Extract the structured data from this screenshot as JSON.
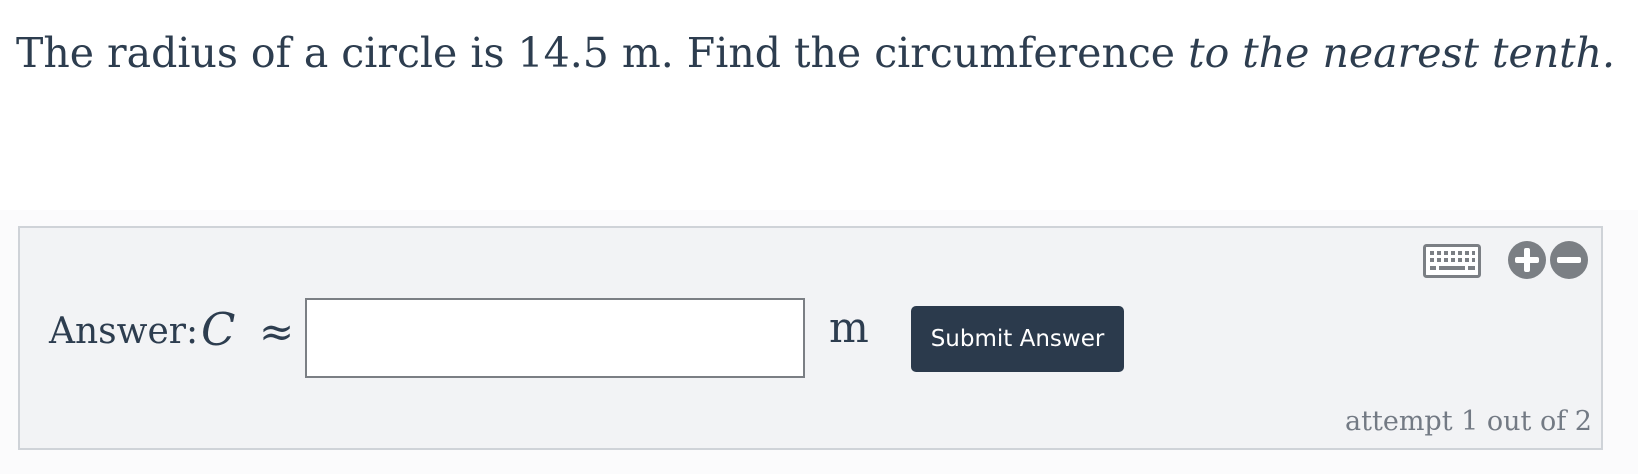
{
  "question": {
    "text_main": "The radius of a circle is 14.5 m. Find the circumference ",
    "text_instruction": "to the nearest tenth."
  },
  "answer": {
    "label": "Answer:",
    "variable": "C",
    "relation": "≈",
    "input_value": "",
    "input_placeholder": "",
    "unit": "m",
    "submit_label": "Submit Answer"
  },
  "tools": {
    "keyboard_icon": "keyboard-icon",
    "zoom_in_icon": "plus-circle-icon",
    "zoom_out_icon": "minus-circle-icon"
  },
  "status": {
    "attempt_text": "attempt 1 out of 2"
  },
  "colors": {
    "text": "#2d3d4f",
    "button_background": "#2b3a4c",
    "panel_background": "#f2f3f5",
    "panel_border": "#cfd3d8",
    "icon_gray": "#7b7f84",
    "muted_text": "#737a84"
  }
}
